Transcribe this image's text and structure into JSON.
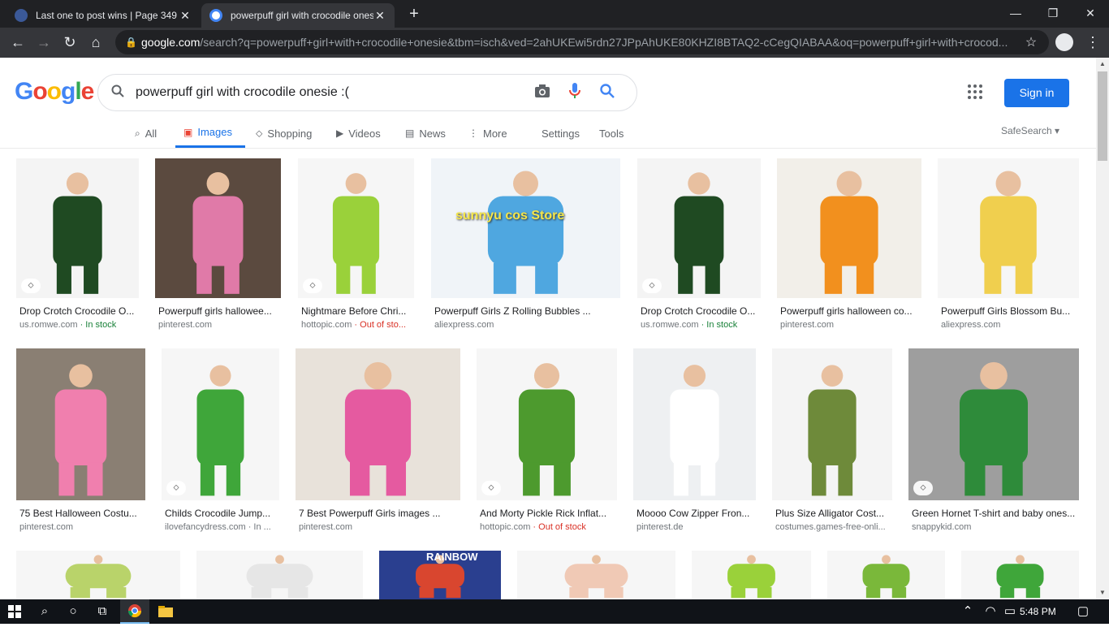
{
  "browser": {
    "tabs": [
      {
        "title": "Last one to post wins | Page 349",
        "favicon_color": "#3b5998"
      },
      {
        "title": "powerpuff girl with crocodile onesie",
        "favicon_color": "#ffffff"
      }
    ],
    "new_tab": "+",
    "window_controls": {
      "minimize": "—",
      "restore": "❐",
      "close": "✕"
    },
    "url_host": "google.com",
    "url_rest": "/search?q=powerpuff+girl+with+crocodile+onesie&tbm=isch&ved=2ahUKEwi5rdn27JPpAhUKE80KHZI8BTAQ2-cCegQIABAA&oq=powerpuff+girl+with+crocod..."
  },
  "google": {
    "logo": "Google",
    "query": "powerpuff girl with crocodile onesie :(",
    "sign_in": "Sign in",
    "tabs": [
      {
        "label": "All",
        "icon": "search-icon"
      },
      {
        "label": "Images",
        "icon": "image-icon"
      },
      {
        "label": "Shopping",
        "icon": "tag-icon"
      },
      {
        "label": "Videos",
        "icon": "play-icon"
      },
      {
        "label": "News",
        "icon": "news-icon"
      },
      {
        "label": "More",
        "icon": "more-icon"
      }
    ],
    "settings": "Settings",
    "tools": "Tools",
    "safesearch": "SafeSearch ▾"
  },
  "results": [
    {
      "title": "Drop Crotch Crocodile O...",
      "source": "us.romwe.com",
      "status": "In stock",
      "status_type": "in",
      "color": "#1f4a22",
      "bg": "#f4f4f4"
    },
    {
      "title": "Powerpuff girls hallowee...",
      "source": "pinterest.com",
      "status": "",
      "status_type": "",
      "color": "#e07aa8",
      "bg": "#5b4a3f"
    },
    {
      "title": "Nightmare Before Chri...",
      "source": "hottopic.com",
      "status": "Out of sto...",
      "status_type": "out",
      "color": "#9ad13a",
      "bg": "#f6f6f6"
    },
    {
      "title": "Powerpuff Girls Z Rolling Bubbles ...",
      "source": "aliexpress.com",
      "status": "",
      "status_type": "",
      "color": "#4fa7e0",
      "bg": "#f0f4f8"
    },
    {
      "title": "Drop Crotch Crocodile O...",
      "source": "us.romwe.com",
      "status": "In stock",
      "status_type": "in",
      "color": "#1f4a22",
      "bg": "#f4f4f4"
    },
    {
      "title": "Powerpuff girls halloween co...",
      "source": "pinterest.com",
      "status": "",
      "status_type": "",
      "color": "#f2901e",
      "bg": "#f2efe9"
    },
    {
      "title": "Powerpuff Girls Blossom Bu...",
      "source": "aliexpress.com",
      "status": "",
      "status_type": "",
      "color": "#f0cf4e",
      "bg": "#f6f6f6"
    },
    {
      "title": "75 Best Halloween Costu...",
      "source": "pinterest.com",
      "status": "",
      "status_type": "",
      "color": "#f07fae",
      "bg": "#8a7f73"
    },
    {
      "title": "Childs Crocodile Jump...",
      "source": "ilovefancydress.com",
      "status": "In ...",
      "status_type": "plain",
      "color": "#3fa63a",
      "bg": "#f6f6f6"
    },
    {
      "title": "7 Best Powerpuff Girls images ...",
      "source": "pinterest.com",
      "status": "",
      "status_type": "",
      "color": "#e55aa0",
      "bg": "#e8e2da"
    },
    {
      "title": "And Morty Pickle Rick Inflat...",
      "source": "hottopic.com",
      "status": "Out of stock",
      "status_type": "out",
      "color": "#4d9a2e",
      "bg": "#f6f6f6"
    },
    {
      "title": "Moooo Cow Zipper Fron...",
      "source": "pinterest.de",
      "status": "",
      "status_type": "",
      "color": "#ffffff",
      "bg": "#eef0f2"
    },
    {
      "title": "Plus Size Alligator Cost...",
      "source": "costumes.games-free-onli...",
      "status": "",
      "status_type": "",
      "color": "#6e8a3a",
      "bg": "#f4f4f4"
    },
    {
      "title": "Green Hornet T-shirt and baby ones...",
      "source": "snappykid.com",
      "status": "",
      "status_type": "",
      "color": "#2e8b3a",
      "bg": "#9e9e9e"
    },
    {
      "title": "",
      "source": "",
      "status": "",
      "status_type": "",
      "color": "#b9d36a",
      "bg": "#f6f6f6"
    },
    {
      "title": "",
      "source": "",
      "status": "",
      "status_type": "",
      "color": "#e6e6e6",
      "bg": "#f6f6f6"
    },
    {
      "title": "",
      "source": "",
      "status": "",
      "status_type": "",
      "color": "#d9462f",
      "bg": "#2a3f8f"
    },
    {
      "title": "",
      "source": "",
      "status": "",
      "status_type": "",
      "color": "#f0c9b5",
      "bg": "#f6f6f6"
    },
    {
      "title": "",
      "source": "",
      "status": "",
      "status_type": "",
      "color": "#9ad13a",
      "bg": "#f6f6f6"
    },
    {
      "title": "",
      "source": "",
      "status": "",
      "status_type": "",
      "color": "#7ab83a",
      "bg": "#f6f6f6"
    },
    {
      "title": "",
      "source": "",
      "status": "",
      "status_type": "",
      "color": "#3fa63a",
      "bg": "#f6f6f6"
    }
  ],
  "rainbow_text": "RAINBOW",
  "overlay_store_text": "sunnyu cos Store",
  "taskbar": {
    "time": "5:48 PM"
  }
}
